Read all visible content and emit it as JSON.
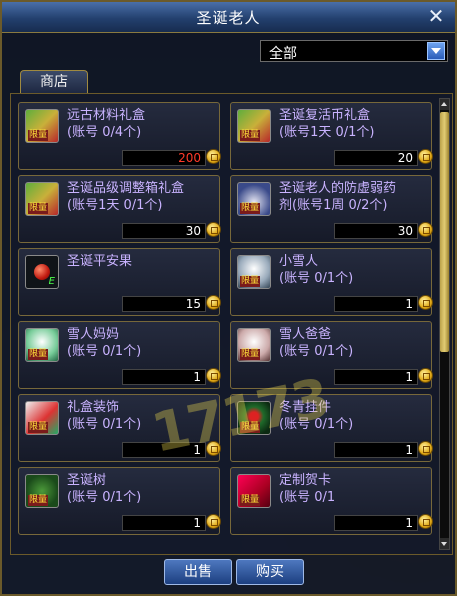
{
  "window": {
    "title": "圣诞老人",
    "close_label": "✕"
  },
  "filter": {
    "selected": "全部"
  },
  "tab": {
    "label": "商店"
  },
  "items": [
    {
      "name": "远古材料礼盒",
      "sub": "(账号 0/4个)",
      "price": "200",
      "price_color": "#ff3a2a",
      "icon": "gift-box-icon",
      "limited": true
    },
    {
      "name": "圣诞复活币礼盒",
      "sub": "(账号1天 0/1个)",
      "price": "20",
      "price_color": "#ffffff",
      "icon": "gift-box-icon",
      "limited": true
    },
    {
      "name": "圣诞品级调整箱礼盒",
      "sub": "(账号1天 0/1个)",
      "price": "30",
      "price_color": "#ffffff",
      "icon": "gift-box-icon",
      "limited": true
    },
    {
      "name": "圣诞老人的防虚弱药",
      "sub": "剂(账号1周 0/2个)",
      "price": "30",
      "price_color": "#ffffff",
      "icon": "potion-icon",
      "limited": true
    },
    {
      "name": "圣诞平安果",
      "sub": "",
      "price": "15",
      "price_color": "#ffffff",
      "icon": "apple-icon",
      "limited": false
    },
    {
      "name": "小雪人",
      "sub": "(账号 0/1个)",
      "price": "1",
      "price_color": "#ffffff",
      "icon": "snowman-icon",
      "limited": true
    },
    {
      "name": "雪人妈妈",
      "sub": "(账号 0/1个)",
      "price": "1",
      "price_color": "#ffffff",
      "icon": "snowman-icon",
      "limited": true
    },
    {
      "name": "雪人爸爸",
      "sub": "(账号 0/1个)",
      "price": "1",
      "price_color": "#ffffff",
      "icon": "snowman-icon",
      "limited": true
    },
    {
      "name": "礼盒装饰",
      "sub": "(账号 0/1个)",
      "price": "1",
      "price_color": "#ffffff",
      "icon": "gift-decoration-icon",
      "limited": true
    },
    {
      "name": "冬青挂件",
      "sub": "(账号 0/1个)",
      "price": "1",
      "price_color": "#ffffff",
      "icon": "holly-icon",
      "limited": true
    },
    {
      "name": "圣诞树",
      "sub": "(账号 0/1个)",
      "price": "1",
      "price_color": "#ffffff",
      "icon": "christmas-tree-icon",
      "limited": true
    },
    {
      "name": "定制贺卡",
      "sub": "(账号 0/1",
      "price": "1",
      "price_color": "#ffffff",
      "icon": "greeting-card-icon",
      "limited": true
    }
  ],
  "limit_badge": "限量",
  "buttons": {
    "sell": "出售",
    "buy": "购买"
  },
  "watermark": "17173"
}
